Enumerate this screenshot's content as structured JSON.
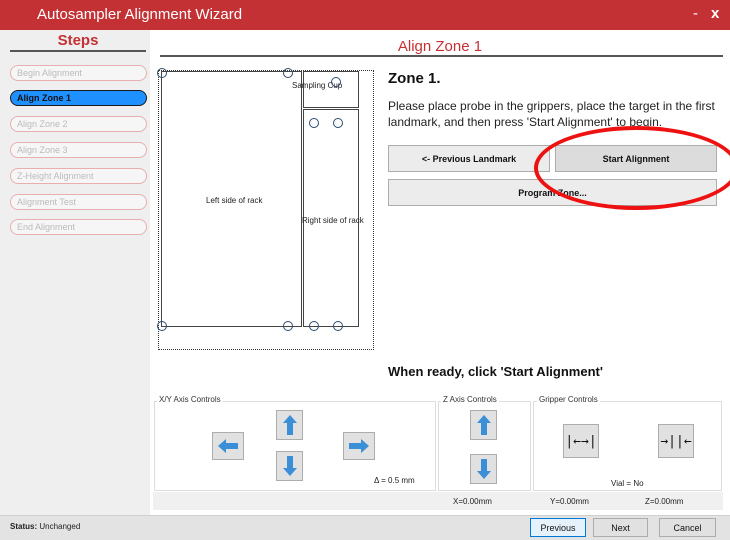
{
  "window": {
    "title": "Autosampler Alignment Wizard",
    "minimize_label": "-",
    "close_label": "x"
  },
  "steps": {
    "header": "Steps",
    "items": [
      {
        "label": "Begin Alignment",
        "active": false
      },
      {
        "label": "Align Zone 1",
        "active": true
      },
      {
        "label": "Align Zone 2",
        "active": false
      },
      {
        "label": "Align Zone 3",
        "active": false
      },
      {
        "label": "Z-Height Alignment",
        "active": false
      },
      {
        "label": "Alignment Test",
        "active": false
      },
      {
        "label": "End Alignment",
        "active": false
      }
    ]
  },
  "main": {
    "header": "Align Zone 1",
    "zone_title": "Zone 1.",
    "instructions": "Please place probe in the grippers, place the target in the first landmark, and then press 'Start Alignment' to begin.",
    "previous_landmark_label": "<- Previous Landmark",
    "start_alignment_label": "Start Alignment",
    "program_zone_label": "Program Zone...",
    "ready_text": "When ready, click 'Start Alignment'"
  },
  "rack": {
    "left_label": "Left side of rack",
    "right_label": "Right side of rack",
    "cup_label": "Sampling Cup"
  },
  "controls": {
    "xy_label": "X/Y Axis Controls",
    "z_label": "Z Axis Controls",
    "gripper_label": "Gripper Controls",
    "delta_text": "Δ = 0.5 mm",
    "vial_text": "Vial = No",
    "gripper_open_glyph": "|←→|",
    "gripper_close_glyph": "→||←"
  },
  "coords": {
    "x": "X=0.00mm",
    "y": "Y=0.00mm",
    "z": "Z=0.00mm"
  },
  "status": {
    "label": "Status:",
    "value": "Unchanged"
  },
  "footer": {
    "previous_label": "Previous",
    "next_label": "Next",
    "cancel_label": "Cancel"
  },
  "colors": {
    "titlebar": "#c43135",
    "accent_blue": "#1e90ff",
    "arrow_blue": "#3a8fd6",
    "highlight_red": "#ee1111"
  },
  "icons": {
    "arrow_left": "arrow-left-icon",
    "arrow_right": "arrow-right-icon",
    "arrow_up": "arrow-up-icon",
    "arrow_down": "arrow-down-icon"
  }
}
